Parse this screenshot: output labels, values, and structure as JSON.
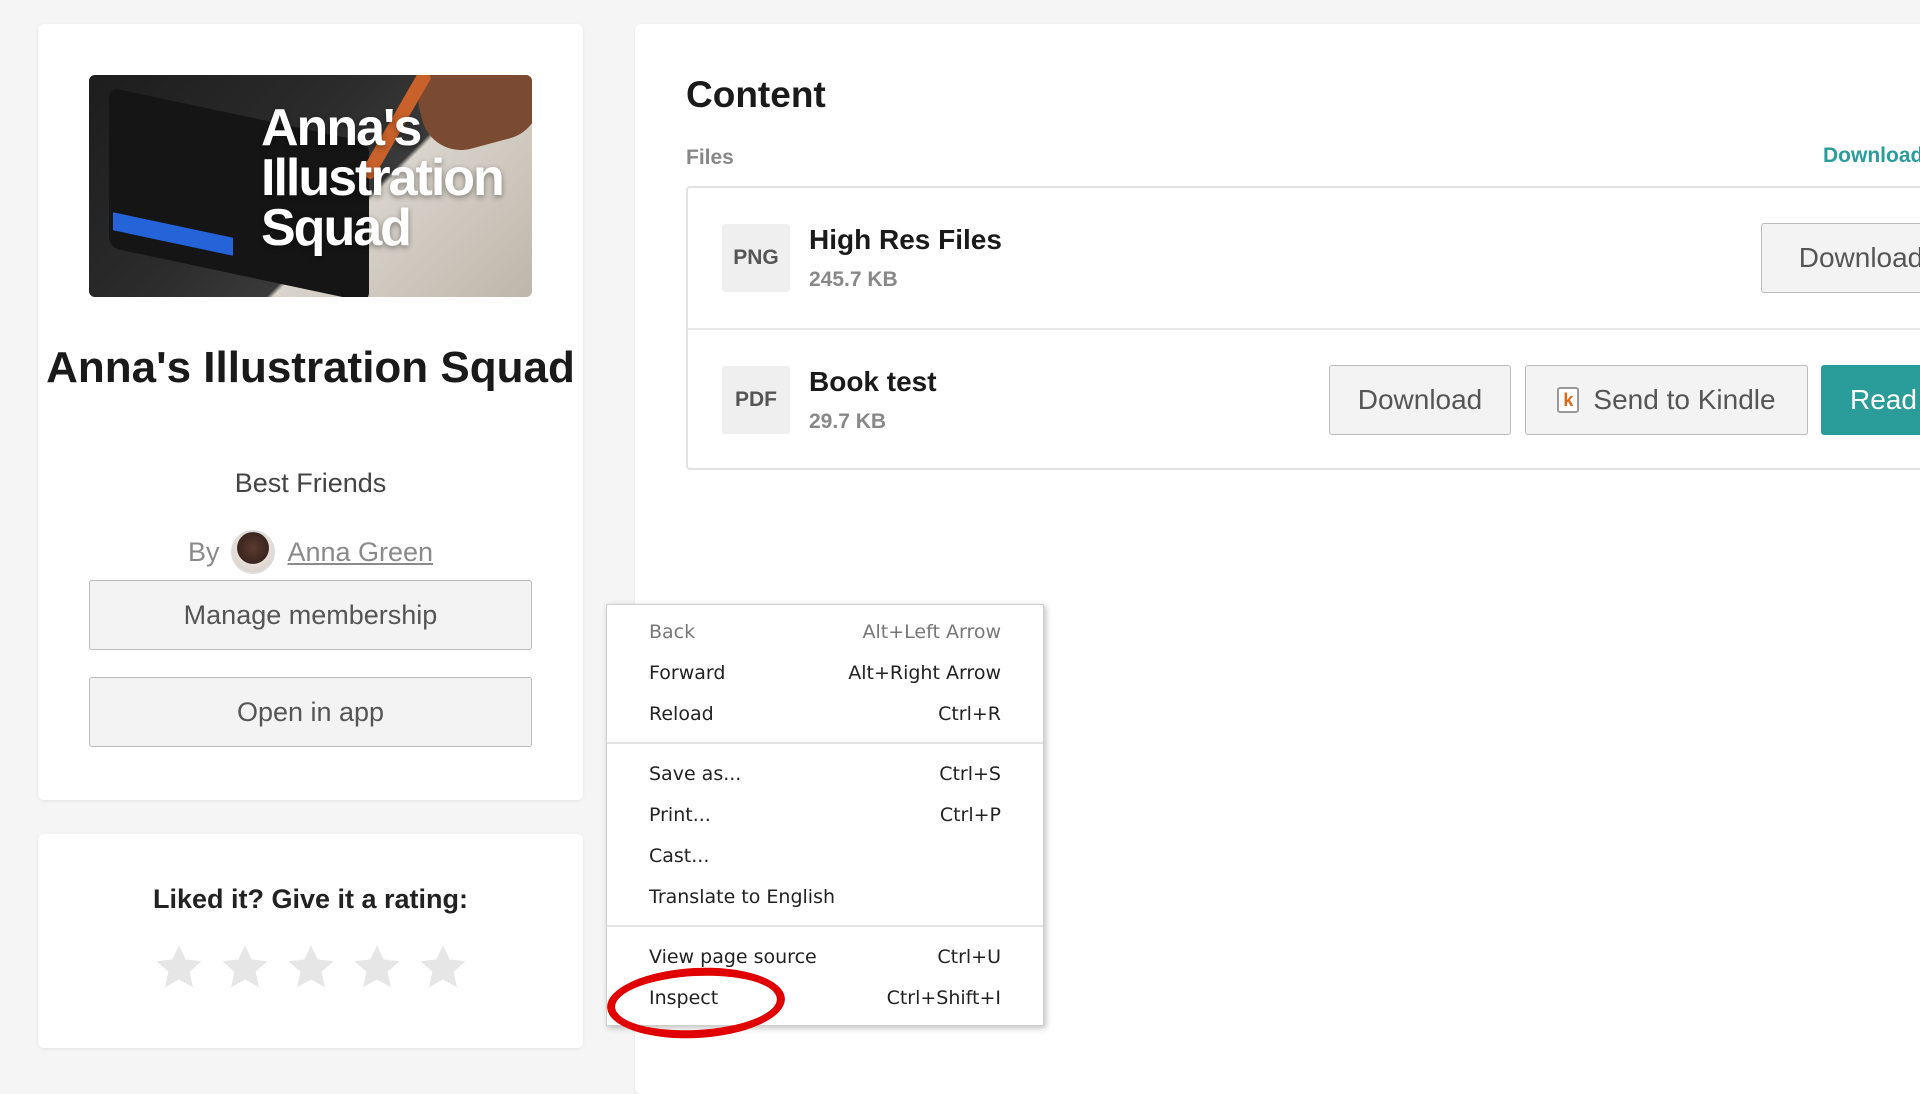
{
  "profile": {
    "cover_title": "Anna's Illustration Squad",
    "creator_name": "Anna's Illustration Squad",
    "tier_name": "Best Friends",
    "by_label": "By",
    "author_name": "Anna Green",
    "manage_label": "Manage membership",
    "open_app_label": "Open in app"
  },
  "rating": {
    "label": "Liked it? Give it a rating:",
    "stars_filled": 0,
    "stars_total": 5
  },
  "content": {
    "title": "Content",
    "files_label": "Files",
    "download_all_label": "Download all",
    "files": [
      {
        "type": "PNG",
        "name": "High Res Files",
        "size": "245.7 KB",
        "download_label": "Download"
      },
      {
        "type": "PDF",
        "name": "Book test",
        "size": "29.7 KB",
        "download_label": "Download",
        "kindle_label": "Send to Kindle",
        "kindle_icon": "k",
        "read_label": "Read"
      }
    ]
  },
  "context_menu": {
    "items": [
      {
        "label": "Back",
        "shortcut": "Alt+Left Arrow"
      },
      {
        "label": "Forward",
        "shortcut": "Alt+Right Arrow"
      },
      {
        "label": "Reload",
        "shortcut": "Ctrl+R"
      },
      {
        "label": "Save as...",
        "shortcut": "Ctrl+S"
      },
      {
        "label": "Print...",
        "shortcut": "Ctrl+P"
      },
      {
        "label": "Cast...",
        "shortcut": ""
      },
      {
        "label": "Translate to English",
        "shortcut": ""
      },
      {
        "label": "View page source",
        "shortcut": "Ctrl+U"
      },
      {
        "label": "Inspect",
        "shortcut": "Ctrl+Shift+I"
      }
    ]
  },
  "colors": {
    "accent": "#2a9d9a",
    "highlight": "#e00000",
    "star": "#e6e6e6"
  }
}
